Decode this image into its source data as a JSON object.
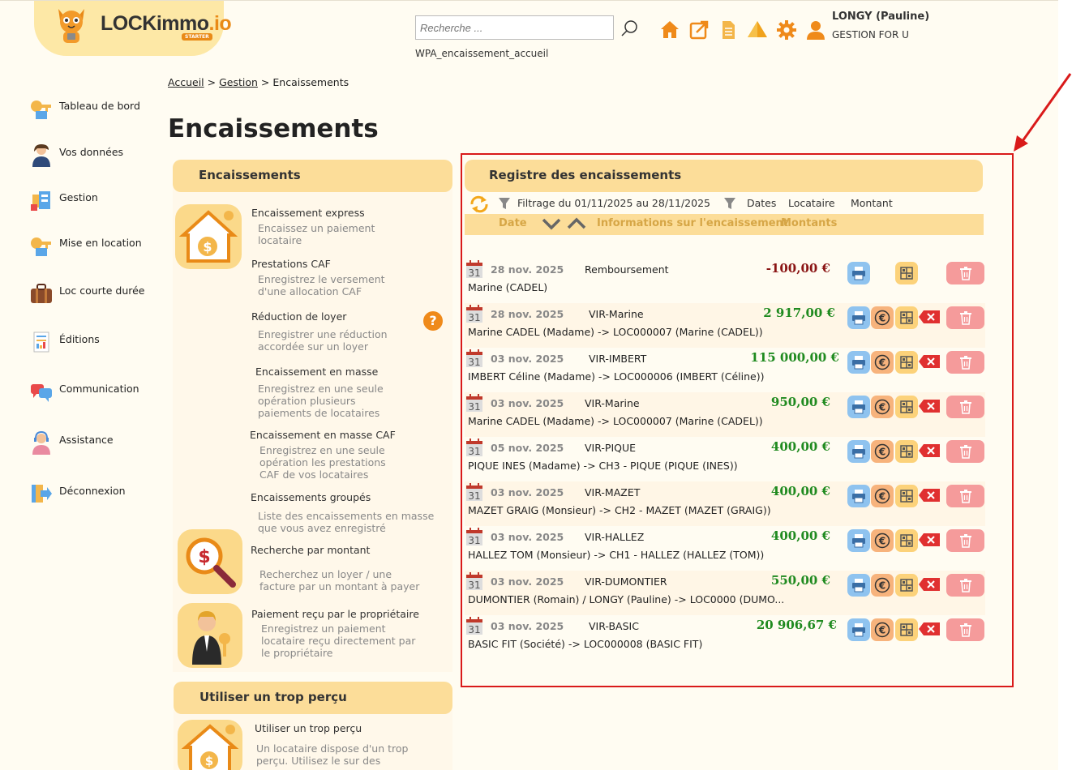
{
  "header": {
    "logo_text_main": "LOCKimmo",
    "logo_text_ext": ".io",
    "logo_badge": "STARTER",
    "search_placeholder": "Recherche ...",
    "page_code": "WPA_encaissement_accueil",
    "user_name": "LONGY (Pauline)",
    "user_org": "GESTION FOR U",
    "icons": [
      "home-icon",
      "external-link-icon",
      "document-icon",
      "warning-icon",
      "gear-icon",
      "user-icon"
    ]
  },
  "colors": {
    "accent": "#ef8a1a",
    "header_band": "#fcdd99",
    "positive": "#1f8a1f",
    "negative": "#8a1414",
    "highlight_frame": "#d91a1a"
  },
  "sidebar": {
    "items": [
      {
        "label": "Tableau de bord",
        "icon": "dashboard-key-icon"
      },
      {
        "label": "Vos données",
        "icon": "user-profile-icon"
      },
      {
        "label": "Gestion",
        "icon": "management-icon"
      },
      {
        "label": "Mise en location",
        "icon": "rental-key-icon"
      },
      {
        "label": "Loc courte durée",
        "icon": "suitcase-icon"
      },
      {
        "label": "Éditions",
        "icon": "report-icon"
      },
      {
        "label": "Communication",
        "icon": "chat-icon"
      },
      {
        "label": "Assistance",
        "icon": "support-icon"
      },
      {
        "label": "Déconnexion",
        "icon": "logout-icon"
      }
    ]
  },
  "breadcrumb": {
    "home": "Accueil",
    "sep": ">",
    "gestion": "Gestion",
    "current": "Encaissements"
  },
  "page_title": "Encaissements",
  "left_panel": {
    "title": "Encaissements",
    "actions": [
      {
        "title": "Encaissement express",
        "desc": [
          "Encaissez un paiement",
          "locataire"
        ]
      },
      {
        "title": "Prestations CAF",
        "desc": [
          "Enregistrez le versement",
          "d'une allocation CAF"
        ]
      },
      {
        "title": "Réduction de loyer",
        "desc": [
          "Enregistrer une réduction",
          "accordée sur un loyer"
        ]
      },
      {
        "title": "Encaissement en masse",
        "desc": [
          "Enregistrez en une seule",
          "opération plusieurs",
          "paiements de locataires"
        ]
      },
      {
        "title": "Encaissement en masse CAF",
        "desc": [
          "Enregistrez en une seule",
          "opération les prestations",
          "CAF de vos locataires"
        ]
      },
      {
        "title": "Encaissements groupés",
        "desc": [
          "Liste des encaissements en masse",
          "que vous avez enregistré"
        ]
      },
      {
        "title": "Recherche par montant",
        "desc": [
          "Recherchez un loyer / une",
          "facture par un montant à payer"
        ]
      },
      {
        "title": "Paiement reçu par le propriétaire",
        "desc": [
          "Enregistrez un paiement",
          "locataire reçu directement par",
          "le propriétaire"
        ]
      }
    ],
    "help": "?"
  },
  "trop_percu": {
    "title": "Utiliser un trop perçu",
    "action_title": "Utiliser un trop perçu",
    "desc": [
      "Un locataire dispose d'un trop",
      "perçu. Utilisez le sur des"
    ]
  },
  "register": {
    "title": "Registre des encaissements",
    "filter_text": "Filtrage du 01/11/2025 au 28/11/2025",
    "filter_dates": "Dates",
    "filter_tenant": "Locataire",
    "filter_amount": "Montant",
    "col_date": "Date",
    "col_info": "Informations sur l'encaissement",
    "col_amounts": "Montants",
    "cal_day": "31",
    "rows": [
      {
        "date": "28 nov. 2025",
        "label": "Remboursement",
        "amount": "-100,00 €",
        "detail": "Marine (CADEL)",
        "negative": true
      },
      {
        "date": "28 nov. 2025",
        "label": "VIR-Marine",
        "amount": "2 917,00 €",
        "detail": "Marine CADEL (Madame) -> LOC000007 (Marine (CADEL))",
        "negative": false
      },
      {
        "date": "03 nov. 2025",
        "label": "VIR-IMBERT",
        "amount": "115 000,00 €",
        "detail": "IMBERT Céline (Madame) -> LOC000006 (IMBERT (Céline))",
        "negative": false
      },
      {
        "date": "03 nov. 2025",
        "label": "VIR-Marine",
        "amount": "950,00 €",
        "detail": "Marine CADEL (Madame) -> LOC000007 (Marine (CADEL))",
        "negative": false
      },
      {
        "date": "05 nov. 2025",
        "label": "VIR-PIQUE",
        "amount": "400,00 €",
        "detail": "PIQUE INES (Madame) -> CH3 - PIQUE (PIQUE (INES))",
        "negative": false
      },
      {
        "date": "03 nov. 2025",
        "label": "VIR-MAZET",
        "amount": "400,00 €",
        "detail": "MAZET GRAIG (Monsieur) -> CH2 - MAZET (MAZET (GRAIG))",
        "negative": false
      },
      {
        "date": "03 nov. 2025",
        "label": "VIR-HALLEZ",
        "amount": "400,00 €",
        "detail": "HALLEZ TOM (Monsieur) -> CH1 - HALLEZ (HALLEZ (TOM))",
        "negative": false
      },
      {
        "date": "03 nov. 2025",
        "label": "VIR-DUMONTIER",
        "amount": "550,00 €",
        "detail": "DUMONTIER (Romain) / LONGY (Pauline) -> LOC0000 (DUMO...",
        "negative": false
      },
      {
        "date": "03 nov. 2025",
        "label": "VIR-BASIC",
        "amount": "20 906,67 €",
        "detail": "BASIC FIT (Société) -> LOC000008 (BASIC FIT)",
        "negative": false
      }
    ]
  }
}
